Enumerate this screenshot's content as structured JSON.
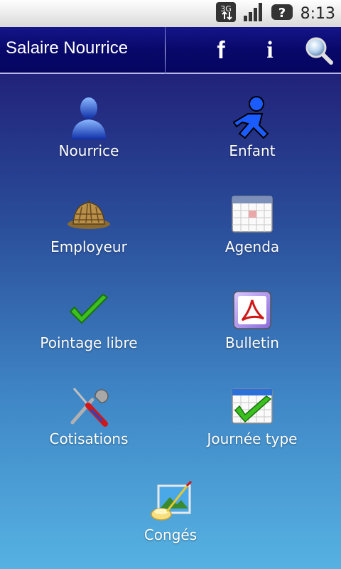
{
  "status_bar": {
    "network_label": "3G",
    "help_icon": "?",
    "time": "8:13"
  },
  "header": {
    "title": "Salaire Nourrice",
    "facebook_label": "f",
    "info_label": "i"
  },
  "menu": {
    "nourrice": "Nourrice",
    "enfant": "Enfant",
    "employeur": "Employeur",
    "agenda": "Agenda",
    "pointage": "Pointage libre",
    "bulletin": "Bulletin",
    "cotisations": "Cotisations",
    "journee": "Journée type",
    "conges": "Congés"
  },
  "colors": {
    "header_bg": "#0a0a6e",
    "gradient_top": "#21227a",
    "gradient_bottom": "#56b2e2"
  }
}
